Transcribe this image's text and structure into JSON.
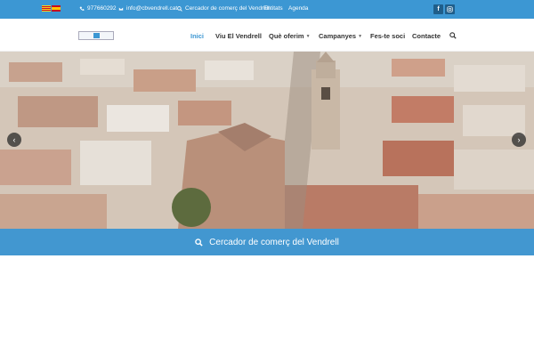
{
  "topbar": {
    "phone": "977660292",
    "email": "info@cbvendrell.cat",
    "search_link": "Cercador de comerç del Vendrell",
    "entitats": "Entitats",
    "agenda": "Agenda",
    "social": [
      "facebook-icon",
      "instagram-icon"
    ]
  },
  "nav": {
    "items": [
      {
        "label": "Inici",
        "active": true
      },
      {
        "label": "Viu El Vendrell"
      },
      {
        "label": "Què oferim",
        "dropdown": true
      },
      {
        "label": "Campanyes",
        "dropdown": true
      },
      {
        "label": "Fes-te soci"
      },
      {
        "label": "Contacte"
      }
    ]
  },
  "hero": {
    "arrow_left": "‹",
    "arrow_right": "›"
  },
  "search_band": {
    "label": "Cercador de comerç del Vendrell"
  },
  "colors": {
    "accent": "#3c97d3",
    "band": "#4297d0"
  }
}
